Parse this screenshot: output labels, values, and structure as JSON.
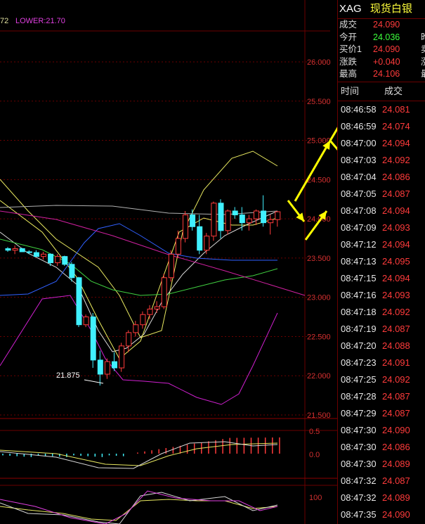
{
  "indicator_label": {
    "prefix": "72",
    "lower": "LOWER:21.70"
  },
  "price_axis": [
    "26.000",
    "25.500",
    "25.000",
    "24.500",
    "24.000",
    "23.500",
    "23.000",
    "22.500",
    "22.000",
    "21.500"
  ],
  "macd_axis": [
    "0.5",
    "0.0"
  ],
  "lower_axis": [
    "100"
  ],
  "low_annotation": "21.875",
  "colors": {
    "up": "#ff3b3b",
    "down": "#40f0ff",
    "grid": "#6b0000",
    "arrow": "#ffff00"
  },
  "panel": {
    "symbol": "XAG",
    "name": "现货白银",
    "name_value": "24.090",
    "quote": [
      {
        "label": "成交",
        "value": "24.090",
        "color": "red",
        "side": ""
      },
      {
        "label": "今开",
        "value": "24.036",
        "color": "green",
        "side": "昨"
      },
      {
        "label": "买价1",
        "value": "24.090",
        "color": "red",
        "side": "卖"
      },
      {
        "label": "涨跌",
        "value": "+0.040",
        "color": "red",
        "side": "涨"
      },
      {
        "label": "最高",
        "value": "24.106",
        "color": "red",
        "side": "最"
      }
    ],
    "tick_header": {
      "time": "时间",
      "price": "成交"
    },
    "ticks": [
      {
        "time": "08:46:58",
        "price": "24.081"
      },
      {
        "time": "08:46:59",
        "price": "24.074"
      },
      {
        "time": "08:47:00",
        "price": "24.094"
      },
      {
        "time": "08:47:03",
        "price": "24.092"
      },
      {
        "time": "08:47:04",
        "price": "24.086"
      },
      {
        "time": "08:47:05",
        "price": "24.087"
      },
      {
        "time": "08:47:08",
        "price": "24.094"
      },
      {
        "time": "08:47:09",
        "price": "24.093"
      },
      {
        "time": "08:47:12",
        "price": "24.094"
      },
      {
        "time": "08:47:13",
        "price": "24.095"
      },
      {
        "time": "08:47:15",
        "price": "24.094"
      },
      {
        "time": "08:47:16",
        "price": "24.093"
      },
      {
        "time": "08:47:18",
        "price": "24.092"
      },
      {
        "time": "08:47:19",
        "price": "24.087"
      },
      {
        "time": "08:47:20",
        "price": "24.088"
      },
      {
        "time": "08:47:23",
        "price": "24.091"
      },
      {
        "time": "08:47:25",
        "price": "24.092"
      },
      {
        "time": "08:47:28",
        "price": "24.087"
      },
      {
        "time": "08:47:29",
        "price": "24.087"
      },
      {
        "time": "08:47:30",
        "price": "24.090"
      },
      {
        "time": "08:47:30",
        "price": "24.086"
      },
      {
        "time": "08:47:30",
        "price": "24.089"
      },
      {
        "time": "08:47:32",
        "price": "24.087"
      },
      {
        "time": "08:47:32",
        "price": "24.089"
      },
      {
        "time": "08:47:35",
        "price": "24.090"
      }
    ]
  },
  "candles": [
    [
      23.62,
      23.64,
      23.58,
      23.6
    ],
    [
      23.6,
      23.66,
      23.55,
      23.62
    ],
    [
      23.62,
      23.63,
      23.58,
      23.58
    ],
    [
      23.58,
      23.6,
      23.55,
      23.57
    ],
    [
      23.57,
      23.6,
      23.52,
      23.52
    ],
    [
      23.52,
      23.58,
      23.48,
      23.55
    ],
    [
      23.55,
      23.56,
      23.4,
      23.44
    ],
    [
      23.44,
      23.55,
      23.4,
      23.52
    ],
    [
      23.52,
      23.53,
      23.4,
      23.42
    ],
    [
      23.42,
      23.45,
      23.2,
      23.25
    ],
    [
      23.25,
      23.26,
      22.62,
      22.65
    ],
    [
      22.65,
      22.78,
      22.62,
      22.75
    ],
    [
      22.75,
      22.8,
      22.1,
      22.2
    ],
    [
      22.2,
      22.32,
      21.875,
      22.02
    ],
    [
      22.02,
      22.22,
      21.96,
      22.18
    ],
    [
      22.18,
      22.3,
      22.06,
      22.1
    ],
    [
      22.1,
      22.42,
      22.05,
      22.38
    ],
    [
      22.38,
      22.58,
      22.3,
      22.55
    ],
    [
      22.55,
      22.7,
      22.5,
      22.65
    ],
    [
      22.65,
      22.82,
      22.6,
      22.78
    ],
    [
      22.78,
      22.9,
      22.72,
      22.85
    ],
    [
      22.85,
      22.95,
      22.8,
      22.88
    ],
    [
      22.88,
      23.3,
      22.85,
      23.25
    ],
    [
      23.25,
      23.6,
      23.2,
      23.55
    ],
    [
      23.55,
      23.85,
      23.5,
      23.75
    ],
    [
      23.75,
      24.1,
      23.7,
      24.05
    ],
    [
      24.05,
      24.12,
      23.85,
      23.9
    ],
    [
      23.9,
      24.05,
      23.55,
      23.6
    ],
    [
      23.6,
      23.82,
      23.55,
      23.78
    ],
    [
      23.78,
      24.22,
      23.72,
      24.2
    ],
    [
      24.2,
      24.25,
      23.75,
      23.85
    ],
    [
      23.85,
      24.12,
      23.8,
      24.1
    ],
    [
      24.1,
      24.15,
      24.0,
      24.05
    ],
    [
      24.05,
      24.15,
      23.85,
      23.95
    ],
    [
      23.95,
      24.05,
      23.85,
      24.0
    ],
    [
      24.0,
      24.12,
      23.92,
      24.1
    ],
    [
      24.1,
      24.3,
      23.9,
      23.95
    ],
    [
      23.95,
      24.05,
      23.8,
      23.99
    ],
    [
      23.99,
      24.1,
      23.9,
      24.09
    ]
  ]
}
